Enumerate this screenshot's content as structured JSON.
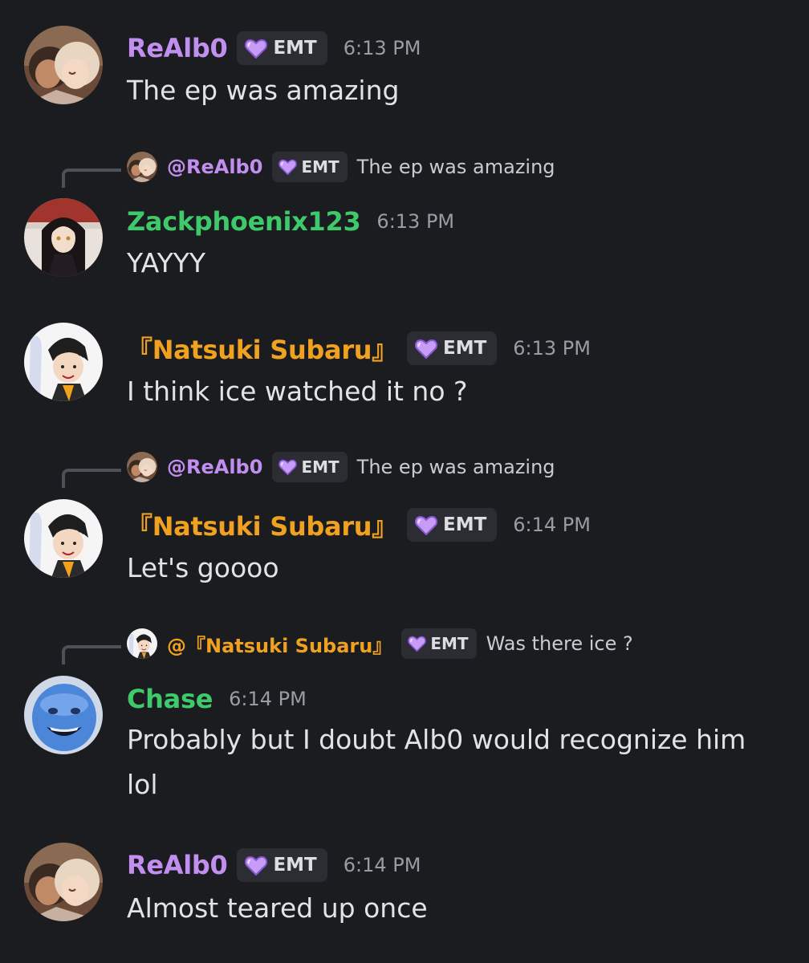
{
  "colors": {
    "background": "#1b1c20",
    "realbo_name": "#c28ef0",
    "green_name": "#3ec96a",
    "subaru_name": "#f0a11f",
    "tag_bg": "#2b2d33",
    "timestamp": "#9a9ca4"
  },
  "tag": {
    "label": "EMT",
    "icon": "purple-heart-icon"
  },
  "messages": [
    {
      "author": "ReAlb0",
      "time": "6:13 PM",
      "text": "The ep was amazing",
      "avatar": "anime-duo-avatar"
    },
    {
      "reply_to": {
        "author": "@ReAlb0",
        "text": "The ep was amazing"
      },
      "author": "Zackphoenix123",
      "time": "6:13 PM",
      "text": "YAYYY",
      "avatar": "dark-hair-girl-avatar"
    },
    {
      "author": "『Natsuki Subaru』",
      "time": "6:13 PM",
      "text": "I think ice watched it no ?",
      "avatar": "subaru-avatar"
    },
    {
      "reply_to": {
        "author": "@ReAlb0",
        "text": "The ep was amazing"
      },
      "author": "『Natsuki Subaru』",
      "time": "6:14 PM",
      "text": "Let's goooo",
      "avatar": "subaru-avatar"
    },
    {
      "reply_to": {
        "author": "@『Natsuki Subaru』",
        "text": "Was there ice ?"
      },
      "author": "Chase",
      "time": "6:14 PM",
      "text": "Probably but I doubt Alb0 would recognize him lol",
      "avatar": "blue-face-avatar"
    },
    {
      "author": "ReAlb0",
      "time": "6:14 PM",
      "text": "Almost teared up once",
      "avatar": "anime-duo-avatar"
    }
  ]
}
